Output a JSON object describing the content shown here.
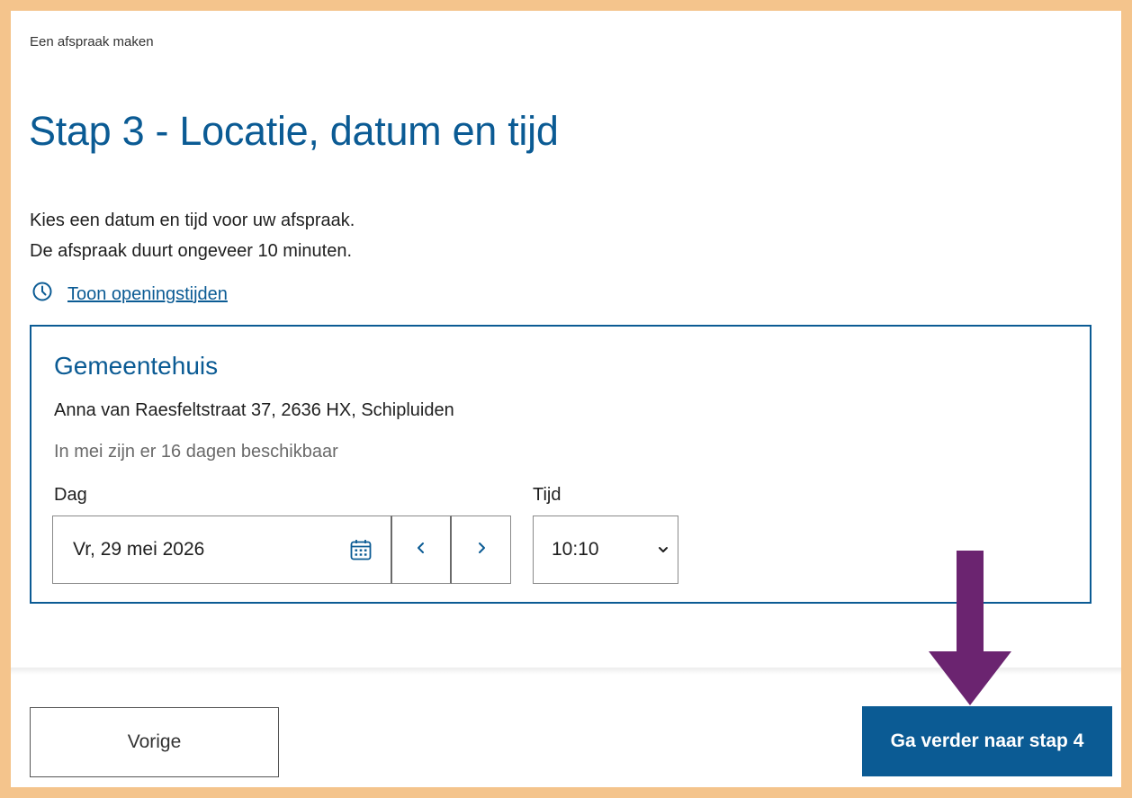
{
  "header": {
    "breadcrumb": "Een afspraak maken",
    "title": "Stap 3 - Locatie, datum en tijd"
  },
  "intro": {
    "line1": "Kies een datum en tijd voor uw afspraak.",
    "line2": "De afspraak duurt ongeveer 10 minuten."
  },
  "opening_hours_link": "Toon openingstijden",
  "location": {
    "name": "Gemeentehuis",
    "address": "Anna van Raesfeltstraat 37, 2636 HX, Schipluiden",
    "availability": "In mei zijn er 16 dagen beschikbaar",
    "day_label": "Dag",
    "day_value": "Vr, 29 mei 2026",
    "time_label": "Tijd",
    "time_value": "10:10"
  },
  "footer": {
    "prev_label": "Vorige",
    "next_label": "Ga verder naar stap 4"
  },
  "icons": {
    "hours": "clock-icon",
    "date": "calendar-icon",
    "prev": "chevron-left-icon",
    "next": "chevron-right-icon",
    "select": "chevron-down-icon",
    "annotation": "arrow-down-icon"
  },
  "colors": {
    "primary": "#0b5b94",
    "frame": "#f4c48c",
    "annotation_arrow": "#6b2470"
  }
}
